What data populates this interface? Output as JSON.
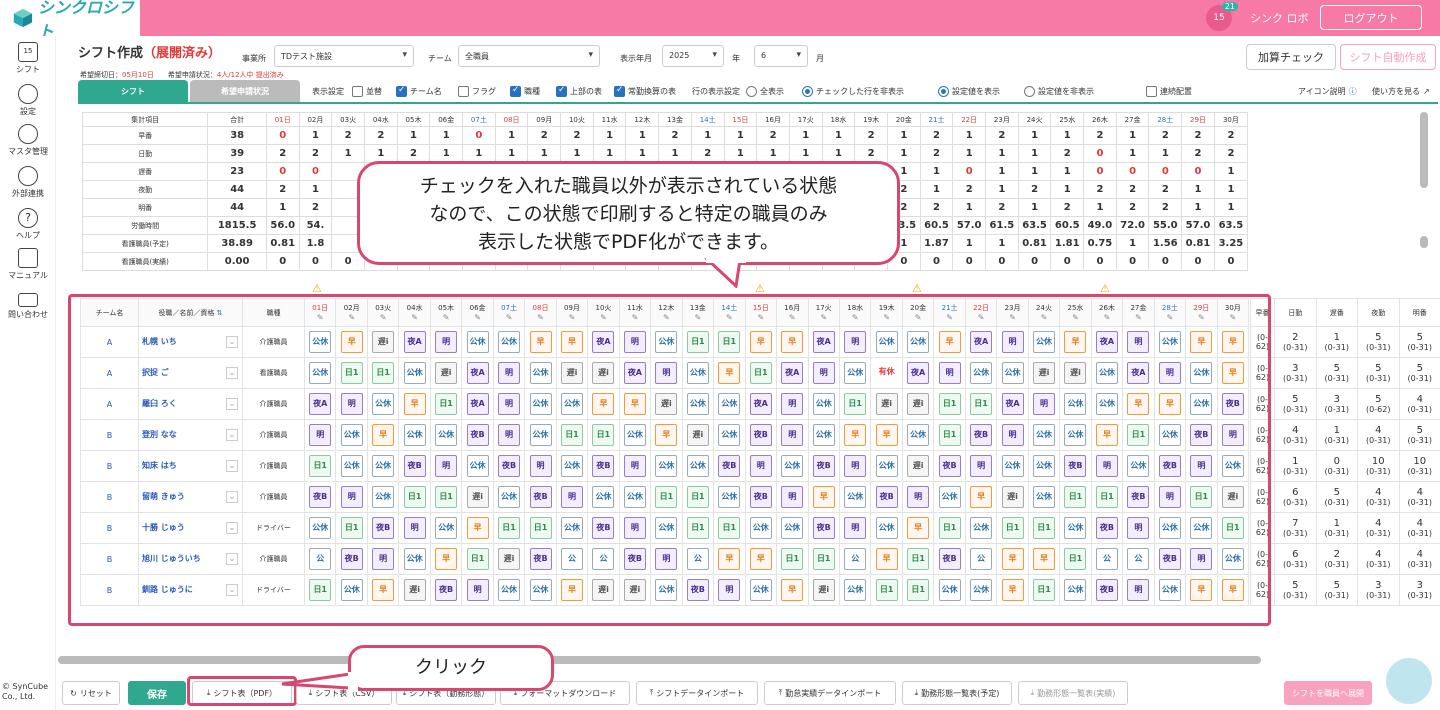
{
  "header": {
    "app_name": "シンクロシフト",
    "calendar_day": "15",
    "notification_count": "21",
    "user": "シンク ロボ",
    "logout": "ログアウト"
  },
  "sidebar": {
    "items": [
      {
        "label": "シフト",
        "icon": "calendar-icon"
      },
      {
        "label": "設定",
        "icon": "gear-icon"
      },
      {
        "label": "マスタ管理",
        "icon": "database-icon"
      },
      {
        "label": "外部連携",
        "icon": "cloud-icon"
      },
      {
        "label": "ヘルプ",
        "icon": "help-icon"
      },
      {
        "label": "マニュアル",
        "icon": "manual-icon"
      },
      {
        "label": "問い合わせ",
        "icon": "mail-icon"
      }
    ],
    "copyright": "© SynCube Co., Ltd."
  },
  "page": {
    "title": "シフト作成",
    "status": "（展開済み）",
    "office_label": "事業所",
    "office_value": "TDテスト施設",
    "team_label": "チーム",
    "team_value": "全職員",
    "year_label": "表示年月",
    "year_value": "2025",
    "year_unit": "年",
    "month_value": "6",
    "month_unit": "月",
    "deadline_label": "希望締切日：",
    "deadline_value": "05月10日",
    "status_label": "希望申請状況：",
    "status_value": "4人/12人中 提出済み",
    "btn_check": "加算チェック",
    "btn_auto": "シフト自動作成"
  },
  "tabs": [
    {
      "label": "シフト"
    },
    {
      "label": "希望申請状況"
    }
  ],
  "settings": {
    "display_label": "表示設定",
    "options": [
      {
        "label": "並替",
        "on": false
      },
      {
        "label": "チーム名",
        "on": true
      },
      {
        "label": "フラグ",
        "on": false
      },
      {
        "label": "職種",
        "on": true
      },
      {
        "label": "上部の表",
        "on": true
      },
      {
        "label": "常勤換算の表",
        "on": true
      }
    ],
    "row_label": "行の表示設定",
    "radio_all": "全表示",
    "radio_hide": "チェックした行を非表示",
    "radio_show_setting": "設定値を表示",
    "radio_hide_setting": "設定値を非表示",
    "consecutive": "連続配置",
    "icon_help": "アイコン説明",
    "how_to": "使い方を見る"
  },
  "days": [
    "01日",
    "02月",
    "03火",
    "04水",
    "05木",
    "06金",
    "07土",
    "08日",
    "09月",
    "10火",
    "11水",
    "12木",
    "13金",
    "14土",
    "15日",
    "16月",
    "17火",
    "18水",
    "19木",
    "20金",
    "21土",
    "22日",
    "23月",
    "24火",
    "25水",
    "26木",
    "27金",
    "28土",
    "29日",
    "30月"
  ],
  "summary": {
    "headers": [
      "集計項目",
      "合計"
    ],
    "rows": [
      {
        "label": "早番",
        "total": "38",
        "vals": [
          "0",
          "1",
          "2",
          "2",
          "1",
          "1",
          "0",
          "1",
          "2",
          "2",
          "1",
          "1",
          "2",
          "1",
          "1",
          "2",
          "1",
          "1",
          "2",
          "1",
          "2",
          "1",
          "2",
          "1",
          "1",
          "2",
          "1",
          "2",
          "2",
          "2"
        ]
      },
      {
        "label": "日勤",
        "total": "39",
        "vals": [
          "2",
          "2",
          "1",
          "1",
          "2",
          "1",
          "1",
          "1",
          "1",
          "1",
          "1",
          "1",
          "1",
          "2",
          "1",
          "1",
          "1",
          "1",
          "2",
          "1",
          "2",
          "1",
          "1",
          "1",
          "2",
          "0",
          "1",
          "1",
          "2",
          "2"
        ]
      },
      {
        "label": "遅番",
        "total": "23",
        "vals": [
          "0",
          "0",
          "",
          "",
          "",
          "",
          "",
          "",
          "",
          "",
          "",
          "",
          "",
          "",
          "",
          "",
          "",
          "",
          "",
          "1",
          "1",
          "0",
          "1",
          "1",
          "1",
          "0",
          "0",
          "0",
          "0",
          "1"
        ]
      },
      {
        "label": "夜勤",
        "total": "44",
        "vals": [
          "2",
          "1",
          "",
          "",
          "",
          "",
          "",
          "",
          "",
          "",
          "",
          "",
          "",
          "",
          "",
          "",
          "",
          "",
          "",
          "2",
          "1",
          "2",
          "1",
          "2",
          "1",
          "2",
          "2",
          "2",
          "1",
          "1"
        ]
      },
      {
        "label": "明番",
        "total": "44",
        "vals": [
          "1",
          "2",
          "",
          "",
          "",
          "",
          "",
          "",
          "",
          "",
          "",
          "",
          "",
          "",
          "",
          "",
          "",
          "",
          "",
          "2",
          "2",
          "1",
          "2",
          "1",
          "2",
          "1",
          "2",
          "2",
          "1",
          "1"
        ]
      },
      {
        "label": "労働時間",
        "total": "1815.5",
        "vals": [
          "56.0",
          "54.",
          "",
          "",
          "",
          "",
          "",
          "",
          "",
          "",
          "",
          "",
          "",
          "",
          "",
          "",
          "",
          "",
          "",
          "63.5",
          "60.5",
          "57.0",
          "61.5",
          "63.5",
          "60.5",
          "49.0",
          "72.0",
          "55.0",
          "57.0",
          "63.5"
        ]
      },
      {
        "label": "看護職員(予定)",
        "total": "38.89",
        "vals": [
          "0.81",
          "1.8",
          "",
          "",
          "",
          "",
          "",
          "",
          "",
          "",
          "",
          "",
          "",
          "",
          "",
          "",
          "",
          "",
          "",
          "1",
          "1.87",
          "1",
          "1",
          "0.81",
          "1.81",
          "0.75",
          "1",
          "1.56",
          "0.81",
          "3.25"
        ]
      },
      {
        "label": "看護職員(実績)",
        "total": "0.00",
        "vals": [
          "0",
          "0",
          "0",
          "0",
          "0",
          "0",
          "0",
          "0",
          "0",
          "0",
          "0",
          "0",
          "0",
          "0",
          "0",
          "0",
          "0",
          "0",
          "0",
          "0",
          "0",
          "0",
          "0",
          "0",
          "0",
          "0",
          "0",
          "0",
          "0",
          "0"
        ]
      }
    ]
  },
  "main": {
    "headers": {
      "team": "チーム名",
      "name": "役職／名前／資格",
      "job": "職種"
    },
    "staff": [
      {
        "team": "A",
        "name": "札幌 いち",
        "job": "介護職員",
        "shifts": [
          "公休",
          "早",
          "遅i",
          "夜A",
          "明",
          "公休",
          "公休",
          "早",
          "早",
          "夜A",
          "明",
          "公休",
          "日1",
          "日1",
          "早",
          "早",
          "夜A",
          "明",
          "公休",
          "公休",
          "早",
          "夜A",
          "明",
          "公休",
          "早",
          "夜A",
          "明",
          "公休",
          "早",
          "早"
        ]
      },
      {
        "team": "A",
        "name": "択捉 ご",
        "job": "看護職員",
        "shifts": [
          "公休",
          "日1",
          "日1",
          "公休",
          "遅i",
          "夜A",
          "明",
          "公休",
          "遅i",
          "遅i",
          "夜A",
          "明",
          "公休",
          "早",
          "日1",
          "夜A",
          "明",
          "公休",
          "有休",
          "夜A",
          "明",
          "公休",
          "公休",
          "遅i",
          "遅i",
          "公休",
          "夜A",
          "明",
          "公休",
          "早"
        ]
      },
      {
        "team": "A",
        "name": "羅臼 ろく",
        "job": "介護職員",
        "shifts": [
          "夜A",
          "明",
          "公休",
          "早",
          "日1",
          "夜A",
          "明",
          "公休",
          "公休",
          "早",
          "早",
          "遅i",
          "公休",
          "公休",
          "夜A",
          "明",
          "公休",
          "日1",
          "遅i",
          "遅i",
          "日1",
          "日1",
          "夜A",
          "明",
          "公休",
          "公休",
          "早",
          "早",
          "公休",
          "夜B"
        ]
      },
      {
        "team": "B",
        "name": "登別 なな",
        "job": "介護職員",
        "shifts": [
          "明",
          "公休",
          "早",
          "公休",
          "公休",
          "夜B",
          "明",
          "公休",
          "日1",
          "日1",
          "公休",
          "早",
          "遅i",
          "公休",
          "夜B",
          "明",
          "公休",
          "早",
          "早",
          "公休",
          "日1",
          "夜B",
          "明",
          "公休",
          "公休",
          "早",
          "日1",
          "公休",
          "夜B",
          "明"
        ]
      },
      {
        "team": "B",
        "name": "知床 はち",
        "job": "介護職員",
        "shifts": [
          "日1",
          "公休",
          "公休",
          "夜B",
          "明",
          "公休",
          "夜B",
          "明",
          "公休",
          "夜B",
          "明",
          "公休",
          "公休",
          "夜B",
          "明",
          "公休",
          "夜B",
          "明",
          "公休",
          "遅i",
          "夜B",
          "明",
          "公休",
          "公休",
          "夜B",
          "明",
          "公休",
          "夜B",
          "明",
          "公休"
        ]
      },
      {
        "team": "B",
        "name": "留萌 きゅう",
        "job": "介護職員",
        "shifts": [
          "夜B",
          "明",
          "公休",
          "日1",
          "日1",
          "遅i",
          "公休",
          "夜B",
          "明",
          "公休",
          "公休",
          "日1",
          "日1",
          "公休",
          "夜B",
          "明",
          "早",
          "公休",
          "夜B",
          "明",
          "公休",
          "早",
          "遅i",
          "公休",
          "日1",
          "日1",
          "夜B",
          "明",
          "日1",
          "遅i"
        ]
      },
      {
        "team": "B",
        "name": "十勝 じゅう",
        "job": "ドライバー",
        "shifts": [
          "公休",
          "日1",
          "夜B",
          "明",
          "公休",
          "早",
          "日1",
          "日1",
          "公休",
          "夜B",
          "明",
          "公休",
          "日1",
          "日1",
          "公休",
          "公休",
          "夜B",
          "明",
          "公休",
          "早",
          "日1",
          "公休",
          "日1",
          "日1",
          "公休",
          "夜B",
          "明",
          "公休",
          "公休",
          "日1"
        ]
      },
      {
        "team": "B",
        "name": "旭川 じゅういち",
        "job": "介護職員",
        "shifts": [
          "公",
          "夜B",
          "明",
          "公休",
          "早",
          "日1",
          "遅i",
          "夜B",
          "公",
          "公",
          "夜B",
          "明",
          "公",
          "早",
          "早",
          "日1",
          "日1",
          "公",
          "早",
          "日1",
          "夜B",
          "公",
          "早",
          "早",
          "日1",
          "公",
          "公",
          "夜B",
          "明",
          "公休"
        ]
      },
      {
        "team": "B",
        "name": "釧路 じゅうに",
        "job": "ドライバー",
        "shifts": [
          "日1",
          "公休",
          "早",
          "遅i",
          "夜B",
          "明",
          "公休",
          "公休",
          "早",
          "遅i",
          "遅i",
          "公休",
          "夜B",
          "明",
          "公休",
          "早",
          "遅i",
          "公休",
          "日1",
          "日1",
          "公休",
          "公休",
          "早",
          "日1",
          "公休",
          "夜B",
          "明",
          "公休",
          "早",
          "早"
        ]
      }
    ],
    "right_headers": [
      "早番",
      "日勤",
      "遅番",
      "夜勤",
      "明番"
    ],
    "right_rows": [
      [
        "",
        "2",
        "1",
        "5",
        "5"
      ],
      [
        "",
        "3",
        "5",
        "5",
        "5"
      ],
      [
        "",
        "5",
        "3",
        "5",
        "4"
      ],
      [
        "",
        "4",
        "1",
        "4",
        "5"
      ],
      [
        "",
        "1",
        "0",
        "10",
        "10"
      ],
      [
        "",
        "6",
        "5",
        "4",
        "4"
      ],
      [
        "",
        "7",
        "1",
        "4",
        "4"
      ],
      [
        "",
        "6",
        "2",
        "4",
        "4"
      ],
      [
        "",
        "5",
        "5",
        "3",
        "3"
      ]
    ],
    "right_ranges": [
      [
        "(0-62)",
        "(0-31)",
        "(0-31)",
        "(0-31)",
        "(0-31)"
      ],
      [
        "(0-62)",
        "(0-31)",
        "(0-31)",
        "(0-31)",
        "(0-31)"
      ],
      [
        "(0-62)",
        "(0-31)",
        "(0-31)",
        "(0-62)",
        "(0-31)"
      ],
      [
        "(0-62)",
        "(0-31)",
        "(0-31)",
        "(0-31)",
        "(0-31)"
      ],
      [
        "(0-62)",
        "(0-31)",
        "(0-31)",
        "(0-31)",
        "(0-31)"
      ],
      [
        "(0-62)",
        "(0-31)",
        "(0-31)",
        "(0-31)",
        "(0-31)"
      ],
      [
        "(0-62)",
        "(0-31)",
        "(0-31)",
        "(0-31)",
        "(0-31)"
      ],
      [
        "(0-62)",
        "(0-31)",
        "(0-31)",
        "(0-31)",
        "(0-31)"
      ],
      [
        "(0-62)",
        "(0-31)",
        "(0-31)",
        "(0-31)",
        "(0-31)"
      ]
    ]
  },
  "callouts": {
    "main_line1": "チェックを入れた職員以外が表示されている状態",
    "main_line2": "なので、この状態で印刷すると特定の職員のみ",
    "main_line3": "表示した状態でPDF化ができます。",
    "click": "クリック"
  },
  "bottom": {
    "reset": "リセット",
    "save": "保存",
    "pdf": "シフト表（PDF）",
    "csv": "シフト表（CSV）",
    "hidden1": "シフト表（勤務形態）",
    "format": "フォーマットダウンロード",
    "import": "シフトデータインポート",
    "att_import": "勤怠実績データインポート",
    "list_plan": "勤務形態一覧表(予定)",
    "list_actual": "勤務形態一覧表(実績)",
    "deploy": "シフトを職員へ展開"
  },
  "colors": {
    "header_pink": "#f77aa6",
    "accent_teal": "#27a9b8",
    "highlight_red": "#d9476f"
  }
}
